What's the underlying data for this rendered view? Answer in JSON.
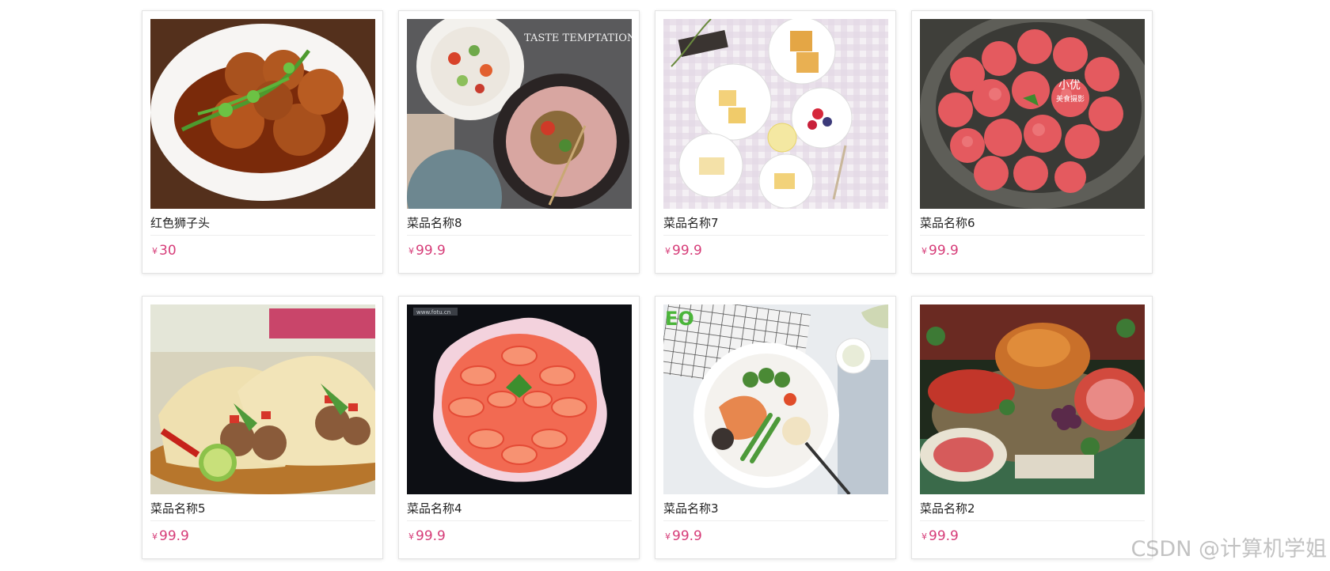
{
  "dishes": [
    {
      "name": "红色狮子头",
      "currency": "¥",
      "price": "30"
    },
    {
      "name": "菜品名称8",
      "currency": "¥",
      "price": "99.9"
    },
    {
      "name": "菜品名称7",
      "currency": "¥",
      "price": "99.9"
    },
    {
      "name": "菜品名称6",
      "currency": "¥",
      "price": "99.9"
    },
    {
      "name": "菜品名称5",
      "currency": "¥",
      "price": "99.9"
    },
    {
      "name": "菜品名称4",
      "currency": "¥",
      "price": "99.9"
    },
    {
      "name": "菜品名称3",
      "currency": "¥",
      "price": "99.9"
    },
    {
      "name": "菜品名称2",
      "currency": "¥",
      "price": "99.9"
    }
  ],
  "photo_overlay_text": {
    "dish8": "TASTE TEMPTATION",
    "dish6_line1": "小优",
    "dish6_line2": "美食摄影",
    "dish4": "www.fotu.cn",
    "dish3": "EO"
  },
  "watermark": "CSDN @计算机学姐",
  "colors": {
    "price": "#d63c78",
    "card_border": "#e3e3e3"
  }
}
